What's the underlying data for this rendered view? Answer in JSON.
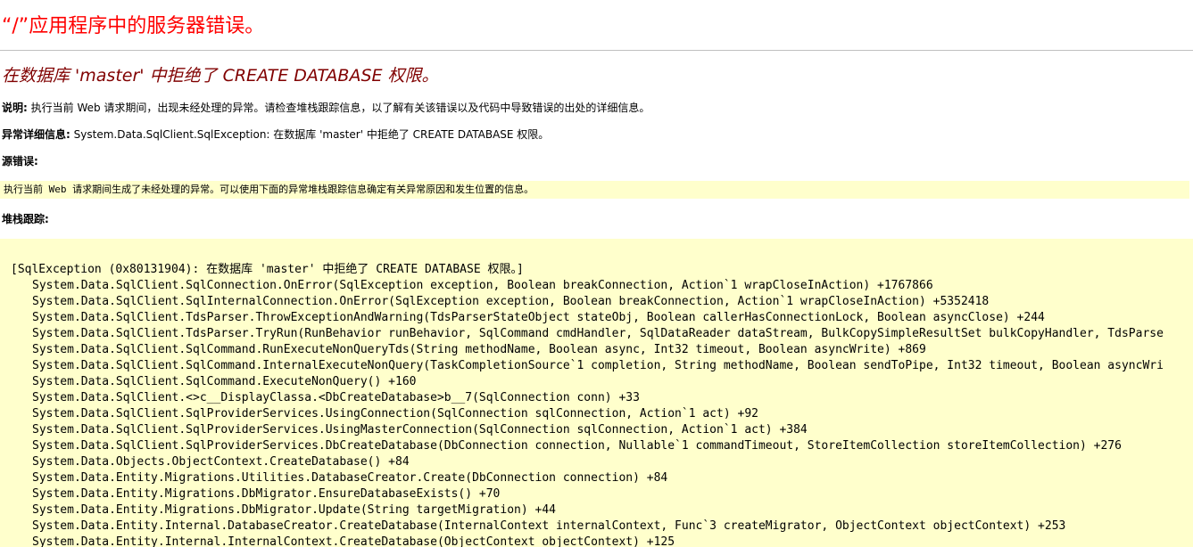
{
  "page": {
    "title": "“/”应用程序中的服务器错误。",
    "error_heading": "在数据库 'master' 中拒绝了 CREATE DATABASE 权限。"
  },
  "description": {
    "label": "说明:",
    "text": "执行当前 Web 请求期间，出现未经处理的异常。请检查堆栈跟踪信息，以了解有关该错误以及代码中导致错误的出处的详细信息。"
  },
  "exception_details": {
    "label": "异常详细信息:",
    "text": "System.Data.SqlClient.SqlException: 在数据库 'master' 中拒绝了 CREATE DATABASE 权限。"
  },
  "source_error": {
    "label": "源错误:",
    "text": "执行当前 Web 请求期间生成了未经处理的异常。可以使用下面的异常堆栈跟踪信息确定有关异常原因和发生位置的信息。"
  },
  "stack_trace": {
    "label": "堆栈跟踪:",
    "header": "[SqlException (0x80131904): 在数据库 'master' 中拒绝了 CREATE DATABASE 权限。]",
    "frames": [
      "System.Data.SqlClient.SqlConnection.OnError(SqlException exception, Boolean breakConnection, Action`1 wrapCloseInAction) +1767866",
      "System.Data.SqlClient.SqlInternalConnection.OnError(SqlException exception, Boolean breakConnection, Action`1 wrapCloseInAction) +5352418",
      "System.Data.SqlClient.TdsParser.ThrowExceptionAndWarning(TdsParserStateObject stateObj, Boolean callerHasConnectionLock, Boolean asyncClose) +244",
      "System.Data.SqlClient.TdsParser.TryRun(RunBehavior runBehavior, SqlCommand cmdHandler, SqlDataReader dataStream, BulkCopySimpleResultSet bulkCopyHandler, TdsParse",
      "System.Data.SqlClient.SqlCommand.RunExecuteNonQueryTds(String methodName, Boolean async, Int32 timeout, Boolean asyncWrite) +869",
      "System.Data.SqlClient.SqlCommand.InternalExecuteNonQuery(TaskCompletionSource`1 completion, String methodName, Boolean sendToPipe, Int32 timeout, Boolean asyncWri",
      "System.Data.SqlClient.SqlCommand.ExecuteNonQuery() +160",
      "System.Data.SqlClient.<>c__DisplayClassa.<DbCreateDatabase>b__7(SqlConnection conn) +33",
      "System.Data.SqlClient.SqlProviderServices.UsingConnection(SqlConnection sqlConnection, Action`1 act) +92",
      "System.Data.SqlClient.SqlProviderServices.UsingMasterConnection(SqlConnection sqlConnection, Action`1 act) +384",
      "System.Data.SqlClient.SqlProviderServices.DbCreateDatabase(DbConnection connection, Nullable`1 commandTimeout, StoreItemCollection storeItemCollection) +276",
      "System.Data.Objects.ObjectContext.CreateDatabase() +84",
      "System.Data.Entity.Migrations.Utilities.DatabaseCreator.Create(DbConnection connection) +84",
      "System.Data.Entity.Migrations.DbMigrator.EnsureDatabaseExists() +70",
      "System.Data.Entity.Migrations.DbMigrator.Update(String targetMigration) +44",
      "System.Data.Entity.Internal.DatabaseCreator.CreateDatabase(InternalContext internalContext, Func`3 createMigrator, ObjectContext objectContext) +253",
      "System.Data.Entity.Internal.InternalContext.CreateDatabase(ObjectContext objectContext) +125"
    ]
  },
  "colors": {
    "title": "#ff0000",
    "heading": "#800000",
    "code_background": "#ffffcc",
    "rule": "#c0c0c0"
  }
}
